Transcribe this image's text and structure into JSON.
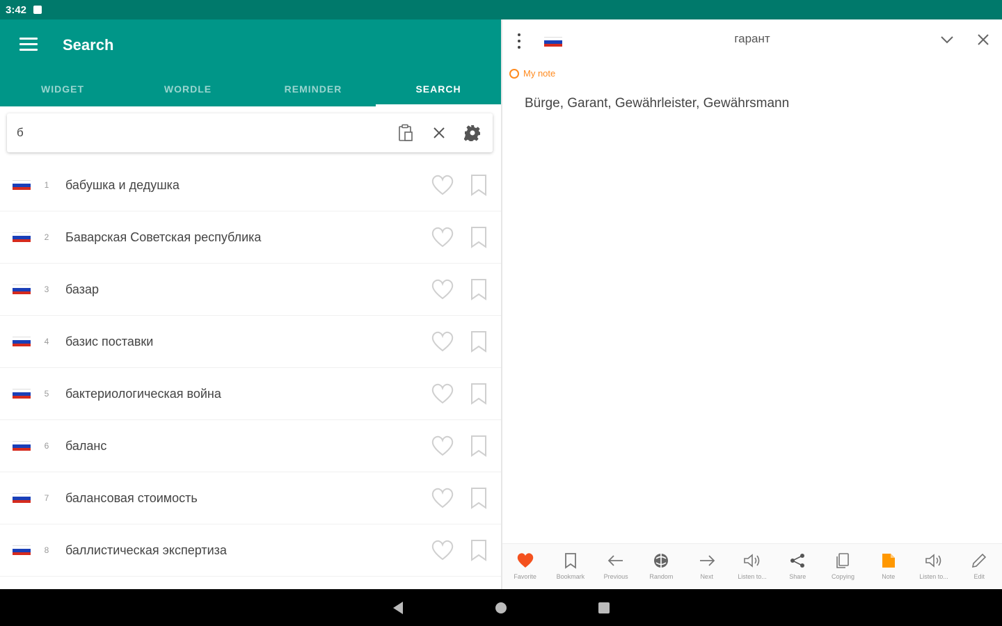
{
  "status_bar": {
    "time": "3:42"
  },
  "header": {
    "title": "Search"
  },
  "tabs": [
    {
      "label": "WIDGET",
      "active": false
    },
    {
      "label": "WORDLE",
      "active": false
    },
    {
      "label": "REMINDER",
      "active": false
    },
    {
      "label": "SEARCH",
      "active": true
    }
  ],
  "search": {
    "query": "б"
  },
  "results": [
    {
      "num": "1",
      "word": "бабушка и дедушка"
    },
    {
      "num": "2",
      "word": "Баварская Советская республика"
    },
    {
      "num": "3",
      "word": "базар"
    },
    {
      "num": "4",
      "word": "базис поставки"
    },
    {
      "num": "5",
      "word": "бактериологическая война"
    },
    {
      "num": "6",
      "word": "баланс"
    },
    {
      "num": "7",
      "word": "балансовая стоимость"
    },
    {
      "num": "8",
      "word": "баллистическая экспертиза"
    }
  ],
  "detail": {
    "word": "гарант",
    "note_label": "My note",
    "translation": "Bürge, Garant, Gewährleister, Gewährsmann"
  },
  "bottom_actions": [
    {
      "label": "Favorite",
      "icon": "heart-icon"
    },
    {
      "label": "Bookmark",
      "icon": "bookmark-icon"
    },
    {
      "label": "Previous",
      "icon": "arrow-left-icon"
    },
    {
      "label": "Random",
      "icon": "random-icon"
    },
    {
      "label": "Next",
      "icon": "arrow-right-icon"
    },
    {
      "label": "Listen to...",
      "icon": "speaker-icon"
    },
    {
      "label": "Share",
      "icon": "share-icon"
    },
    {
      "label": "Copying",
      "icon": "copy-icon"
    },
    {
      "label": "Note",
      "icon": "note-icon"
    },
    {
      "label": "Listen to...",
      "icon": "speaker-icon"
    },
    {
      "label": "Edit",
      "icon": "pencil-icon"
    }
  ],
  "colors": {
    "primary": "#009688",
    "primary_dark": "#00796b",
    "accent": "#ff8a1e",
    "favorite": "#f4511e"
  }
}
